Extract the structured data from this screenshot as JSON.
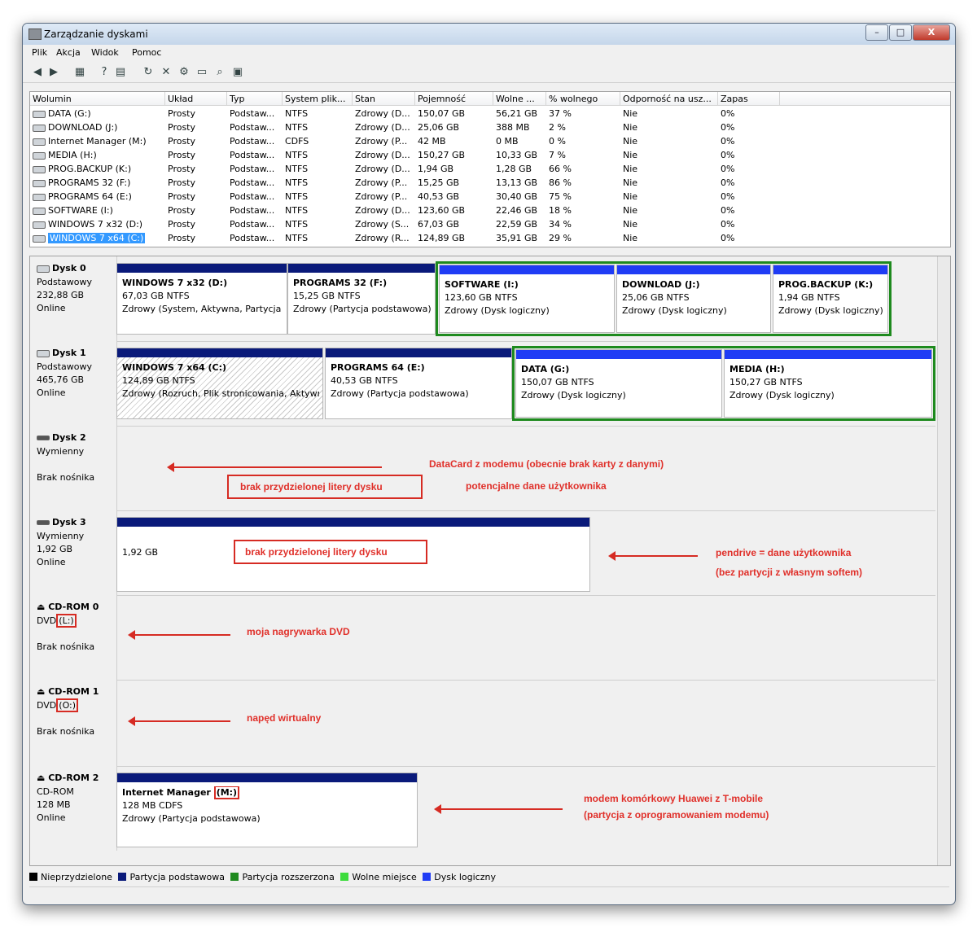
{
  "window": {
    "title": "Zarządzanie dyskami",
    "minimize": "–",
    "maximize": "□",
    "close": "X"
  },
  "menu": [
    "Plik",
    "Akcja",
    "Widok",
    "Pomoc"
  ],
  "toolbar_icons": [
    "back-icon",
    "forward-icon",
    "properties-grid-icon",
    "help-icon",
    "view-icon",
    "refresh-icon",
    "delete-icon",
    "settings-icon",
    "open-folder-icon",
    "search-icon",
    "disk-wizard-icon"
  ],
  "volumes": {
    "headers": [
      "Wolumin",
      "Układ",
      "Typ",
      "System plik...",
      "Stan",
      "Pojemność",
      "Wolne ...",
      "% wolnego",
      "Odporność na usz...",
      "Zapas"
    ],
    "rows": [
      [
        "DATA (G:)",
        "Prosty",
        "Podstaw...",
        "NTFS",
        "Zdrowy (D...",
        "150,07 GB",
        "56,21 GB",
        "37 %",
        "Nie",
        "0%"
      ],
      [
        "DOWNLOAD (J:)",
        "Prosty",
        "Podstaw...",
        "NTFS",
        "Zdrowy (D...",
        "25,06 GB",
        "388 MB",
        "2 %",
        "Nie",
        "0%"
      ],
      [
        "Internet Manager (M:)",
        "Prosty",
        "Podstaw...",
        "CDFS",
        "Zdrowy (P...",
        "42 MB",
        "0 MB",
        "0 %",
        "Nie",
        "0%"
      ],
      [
        "MEDIA (H:)",
        "Prosty",
        "Podstaw...",
        "NTFS",
        "Zdrowy (D...",
        "150,27 GB",
        "10,33 GB",
        "7 %",
        "Nie",
        "0%"
      ],
      [
        "PROG.BACKUP (K:)",
        "Prosty",
        "Podstaw...",
        "NTFS",
        "Zdrowy (D...",
        "1,94 GB",
        "1,28 GB",
        "66 %",
        "Nie",
        "0%"
      ],
      [
        "PROGRAMS 32 (F:)",
        "Prosty",
        "Podstaw...",
        "NTFS",
        "Zdrowy (P...",
        "15,25 GB",
        "13,13 GB",
        "86 %",
        "Nie",
        "0%"
      ],
      [
        "PROGRAMS 64 (E:)",
        "Prosty",
        "Podstaw...",
        "NTFS",
        "Zdrowy (P...",
        "40,53 GB",
        "30,40 GB",
        "75 %",
        "Nie",
        "0%"
      ],
      [
        "SOFTWARE (I:)",
        "Prosty",
        "Podstaw...",
        "NTFS",
        "Zdrowy (D...",
        "123,60 GB",
        "22,46 GB",
        "18 %",
        "Nie",
        "0%"
      ],
      [
        "WINDOWS 7 x32 (D:)",
        "Prosty",
        "Podstaw...",
        "NTFS",
        "Zdrowy (S...",
        "67,03 GB",
        "22,59 GB",
        "34 %",
        "Nie",
        "0%"
      ],
      [
        "WINDOWS 7 x64 (C:)",
        "Prosty",
        "Podstaw...",
        "NTFS",
        "Zdrowy (R...",
        "124,89 GB",
        "35,91 GB",
        "29 %",
        "Nie",
        "0%"
      ]
    ]
  },
  "disks": {
    "d0": {
      "name": "Dysk 0",
      "type": "Podstawowy",
      "size": "232,88 GB",
      "status": "Online",
      "parts": [
        {
          "name": "WINDOWS 7 x32 (D:)",
          "size": "67,03 GB NTFS",
          "state": "Zdrowy (System, Aktywna, Partycja p"
        },
        {
          "name": "PROGRAMS 32 (F:)",
          "size": "15,25 GB NTFS",
          "state": "Zdrowy (Partycja podstawowa)"
        },
        {
          "name": "SOFTWARE (I:)",
          "size": "123,60 GB NTFS",
          "state": "Zdrowy (Dysk logiczny)"
        },
        {
          "name": "DOWNLOAD (J:)",
          "size": "25,06 GB NTFS",
          "state": "Zdrowy (Dysk logiczny)"
        },
        {
          "name": "PROG.BACKUP (K:)",
          "size": "1,94 GB NTFS",
          "state": "Zdrowy (Dysk logiczny)"
        }
      ]
    },
    "d1": {
      "name": "Dysk 1",
      "type": "Podstawowy",
      "size": "465,76 GB",
      "status": "Online",
      "parts": [
        {
          "name": "WINDOWS 7 x64 (C:)",
          "size": "124,89 GB NTFS",
          "state": "Zdrowy (Rozruch, Plik stronicowania, Aktywn"
        },
        {
          "name": "PROGRAMS 64 (E:)",
          "size": "40,53 GB NTFS",
          "state": "Zdrowy (Partycja podstawowa)"
        },
        {
          "name": "DATA (G:)",
          "size": "150,07 GB NTFS",
          "state": "Zdrowy (Dysk logiczny)"
        },
        {
          "name": "MEDIA (H:)",
          "size": "150,27 GB NTFS",
          "state": "Zdrowy (Dysk logiczny)"
        }
      ]
    },
    "d2": {
      "name": "Dysk 2",
      "type": "Wymienny",
      "status": "Brak nośnika"
    },
    "d3": {
      "name": "Dysk 3",
      "type": "Wymienny",
      "size": "1,92 GB",
      "status": "Online",
      "part_size": "1,92 GB"
    },
    "cd0": {
      "name": "CD-ROM 0",
      "type": "DVD",
      "letter": "(L:)",
      "status": "Brak nośnika"
    },
    "cd1": {
      "name": "CD-ROM 1",
      "type": "DVD",
      "letter": "(O:)",
      "status": "Brak nośnika"
    },
    "cd2": {
      "name": "CD-ROM 2",
      "type": "CD-ROM",
      "size": "128 MB",
      "status": "Online",
      "part": {
        "name": "Internet Manager",
        "letter": "(M:)",
        "size": "128 MB CDFS",
        "state": "Zdrowy (Partycja podstawowa)"
      }
    }
  },
  "annotations": {
    "d2_main": "DataCard  z  modemu (obecnie brak karty z danymi)",
    "d2_box": "brak przydzielonej litery dysku",
    "d2_sub": "potencjalne dane użytkownika",
    "d3_box": "brak przydzielonej litery dysku",
    "d3_line1": "pendrive  =  dane użytkownika",
    "d3_line2": "(bez partycji z własnym softem)",
    "cd0": "moja nagrywarka DVD",
    "cd1": "napęd wirtualny",
    "cd2_line1": "modem komórkowy Huawei z T-mobile",
    "cd2_line2": "(partycja z oprogramowaniem modemu)"
  },
  "legend": [
    {
      "label": "Nieprzydzielone",
      "color": "#000000"
    },
    {
      "label": "Partycja podstawowa",
      "color": "#0a1a7a"
    },
    {
      "label": "Partycja rozszerzona",
      "color": "#1e8a1e"
    },
    {
      "label": "Wolne miejsce",
      "color": "#3ddc3d"
    },
    {
      "label": "Dysk logiczny",
      "color": "#1f3cf5"
    }
  ]
}
